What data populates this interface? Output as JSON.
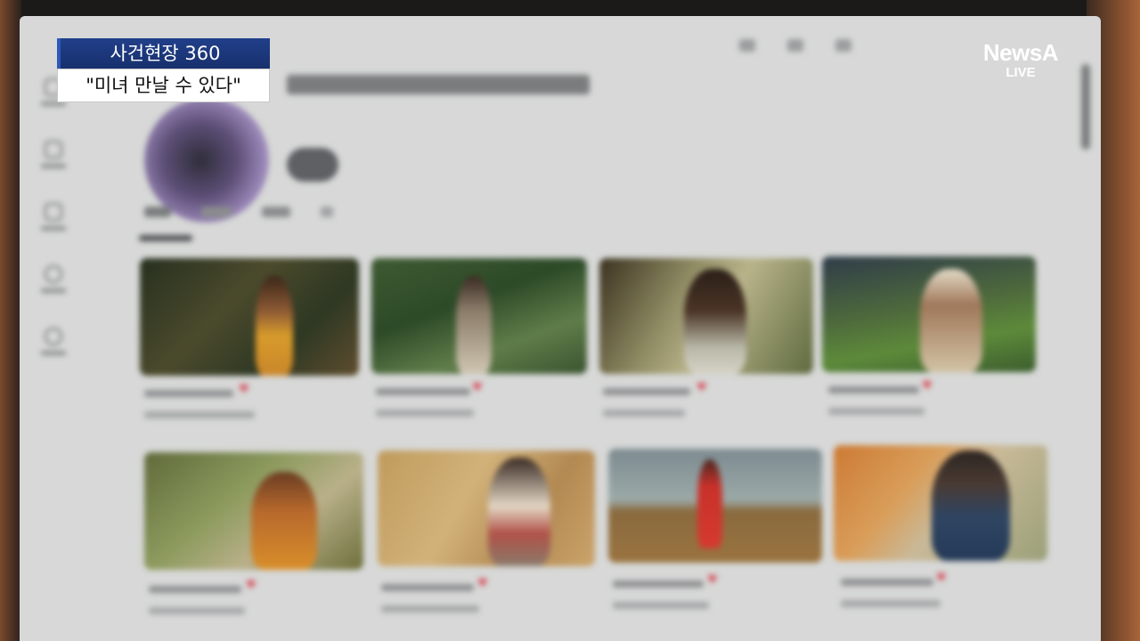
{
  "caption": {
    "program": "사건현장 360",
    "quote": "\"미녀 만날 수 있다\""
  },
  "logo": {
    "brand": "NewsA",
    "live": "LIVE"
  },
  "colors": {
    "caption_blue": "#1b3a80",
    "heart_red": "#d44a57"
  },
  "icons": [
    "home-icon",
    "shorts-icon",
    "subscriptions-icon",
    "account-icon",
    "history-icon",
    "heart-icon"
  ]
}
